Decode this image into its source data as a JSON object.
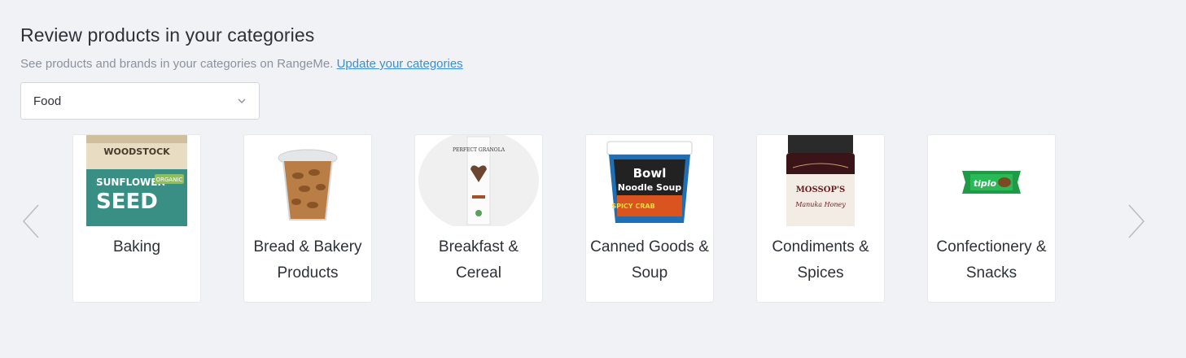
{
  "header": {
    "title": "Review products in your categories",
    "subtitle": "See products and brands in your categories on RangeMe.",
    "update_link": "Update your categories"
  },
  "category_select": {
    "value": "Food",
    "icon": "chevron-down-icon"
  },
  "carousel": {
    "prev_icon": "chevron-left-icon",
    "next_icon": "chevron-right-icon",
    "cards": [
      {
        "label": "Baking",
        "image": "sunflower-seed-butter-jar",
        "image_text": {
          "brand": "WOODSTOCK",
          "line1": "SUNFLOWER",
          "line2": "SEED",
          "badge": "ORGANIC"
        }
      },
      {
        "label": "Bread & Bakery Products",
        "image": "almonds-cup"
      },
      {
        "label": "Breakfast & Cereal",
        "image": "granola-pouch",
        "image_text": {
          "brand": "PERFECT GRANOLA"
        }
      },
      {
        "label": "Canned Goods & Soup",
        "image": "bowl-noodle-soup-tub",
        "image_text": {
          "line1": "Bowl",
          "line2": "Noodle Soup",
          "flavor": "SPICY CRAB"
        }
      },
      {
        "label": "Condiments & Spices",
        "image": "manuka-honey-jar",
        "image_text": {
          "brand": "MOSSOP'S",
          "product": "Manuka Honey"
        }
      },
      {
        "label": "Confectionery & Snacks",
        "image": "tiplo-chocolate-bar",
        "image_text": {
          "brand": "tiplo"
        }
      }
    ]
  }
}
